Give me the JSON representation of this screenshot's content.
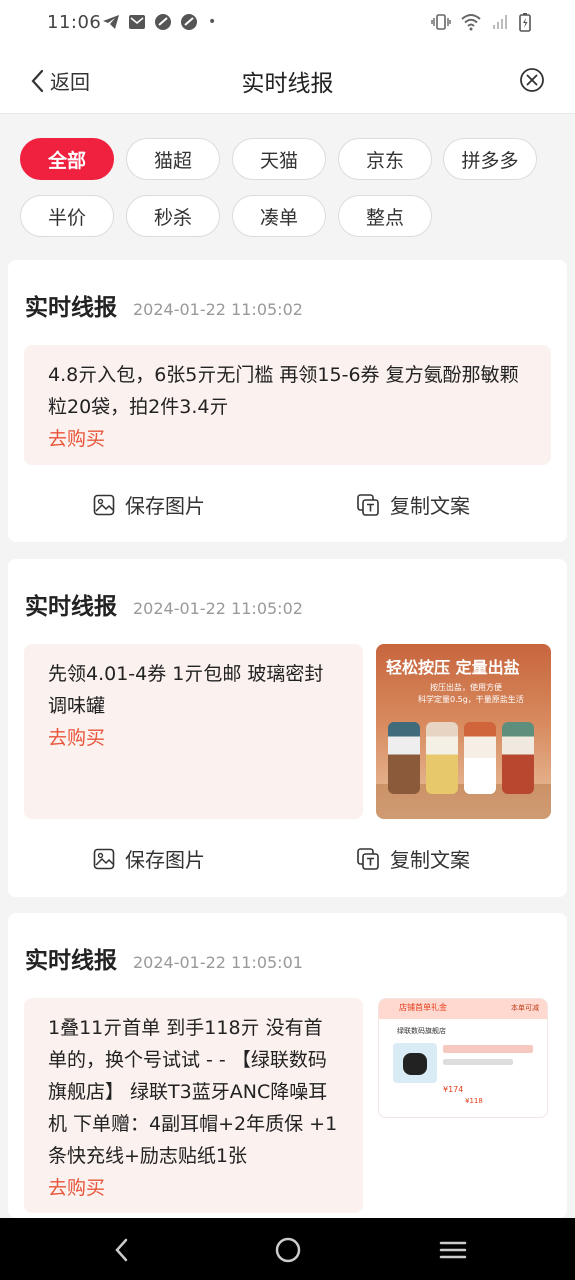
{
  "status_bar": {
    "time": "11:06",
    "dot": "•"
  },
  "header": {
    "back_label": "返回",
    "title": "实时线报"
  },
  "filters": [
    {
      "label": "全部",
      "active": true
    },
    {
      "label": "猫超",
      "active": false
    },
    {
      "label": "天猫",
      "active": false
    },
    {
      "label": "京东",
      "active": false
    },
    {
      "label": "拼多多",
      "active": false
    },
    {
      "label": "半价",
      "active": false
    },
    {
      "label": "秒杀",
      "active": false
    },
    {
      "label": "凑单",
      "active": false
    },
    {
      "label": "整点",
      "active": false
    }
  ],
  "cards": [
    {
      "title": "实时线报",
      "time": "2024-01-22 11:05:02",
      "text": "4.8亓入包，6张5亓无门槛 再领15-6券 复方氨酚那敏颗粒20袋，拍2件3.4亓",
      "buy": "去购买",
      "save_label": "保存图片",
      "copy_label": "复制文案"
    },
    {
      "title": "实时线报",
      "time": "2024-01-22 11:05:02",
      "text": "先领4.01-4券 1亓包邮 玻璃密封调味罐",
      "buy": "去购买",
      "save_label": "保存图片",
      "copy_label": "复制文案",
      "image": {
        "headline": "轻松按压  定量出盐",
        "sub1": "按压出盐，使用方便",
        "sub2": "科学定量0.5g，干量原盐生活"
      }
    },
    {
      "title": "实时线报",
      "time": "2024-01-22 11:05:01",
      "text": "1叠11亓首单 到手118亓 没有首单的，换个号试试 - - 【绿联数码旗舰店】 绿联T3蓝牙ANC降噪耳机 下单赠：4副耳帽+2年质保 +1条快充线+励志贴纸1张",
      "buy": "去购买",
      "image": {
        "banner": "店铺首单礼金",
        "banner_note": "本单可减",
        "shop": "绿联数码旗舰店",
        "price": "¥174",
        "final": "¥118"
      }
    }
  ],
  "colors": {
    "accent": "#f0213f",
    "buy_link": "#e8553a",
    "content_bg": "#fbf1ef"
  }
}
